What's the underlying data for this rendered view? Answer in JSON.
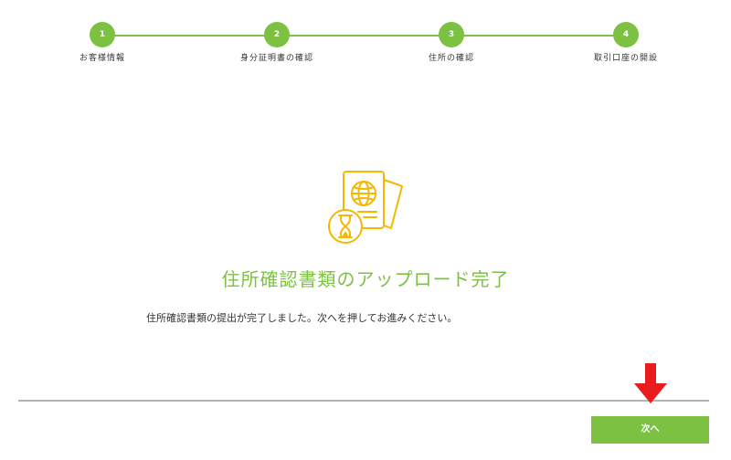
{
  "stepper": {
    "steps": [
      {
        "number": "1",
        "label": "お客様情報"
      },
      {
        "number": "2",
        "label": "身分証明書の確認"
      },
      {
        "number": "3",
        "label": "住所の確認"
      },
      {
        "number": "4",
        "label": "取引口座の開設"
      }
    ]
  },
  "main": {
    "title": "住所確認書類のアップロード完了",
    "message": "住所確認書類の提出が完了しました。次へを押してお進みください。"
  },
  "footer": {
    "next_label": "次へ"
  },
  "colors": {
    "accent_green": "#7dc142",
    "icon_yellow": "#f5b800",
    "arrow_red": "#e81c1c",
    "divider_gray": "#b3b3b3"
  },
  "icons": {
    "hero": "passport-hourglass-icon",
    "pointer": "arrow-down-icon"
  }
}
